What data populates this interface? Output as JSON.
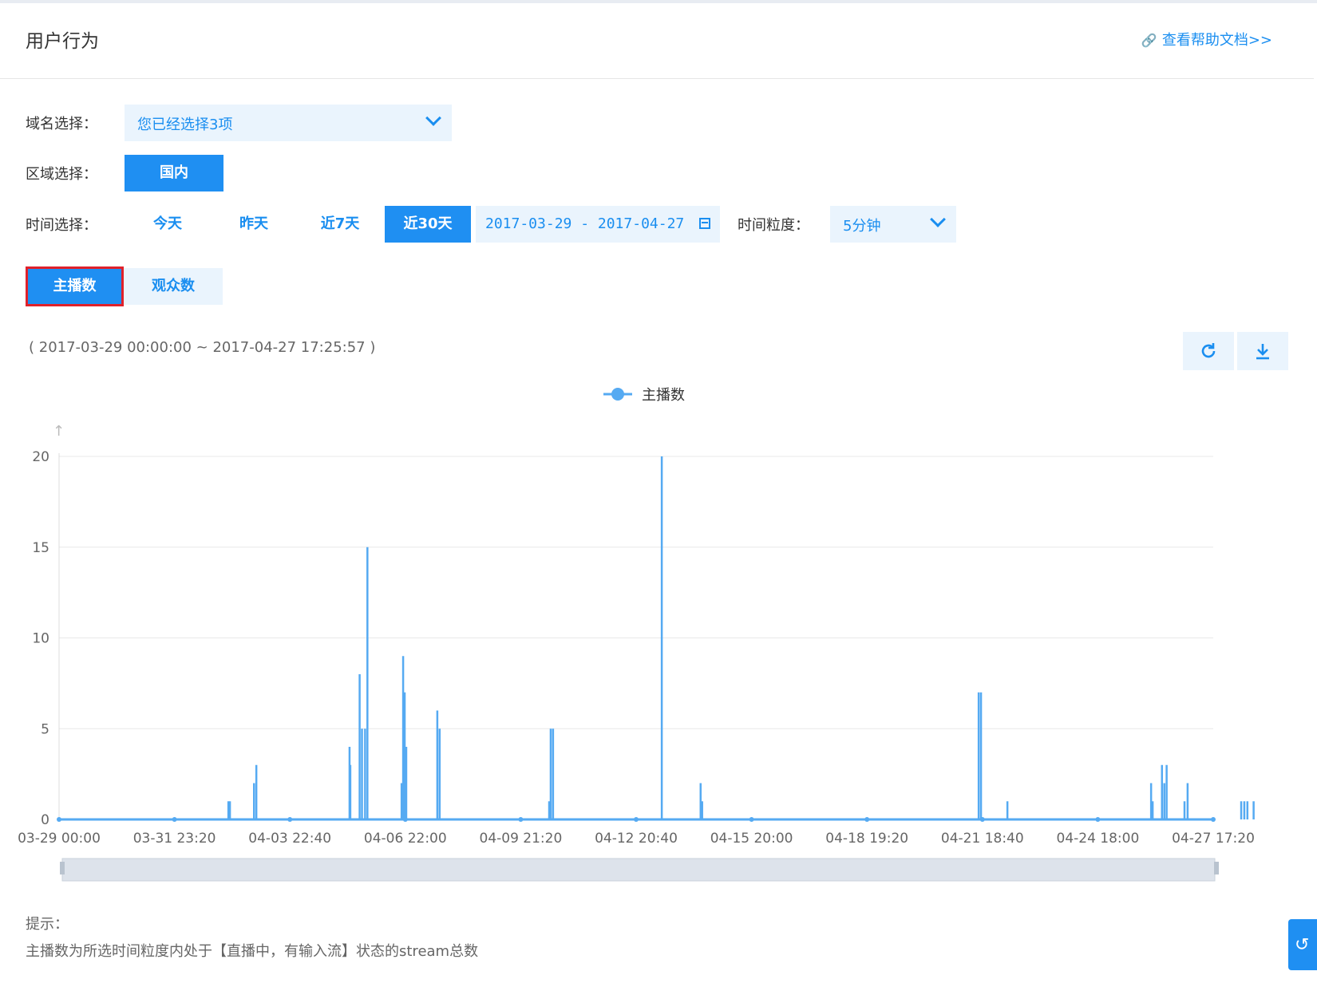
{
  "header": {
    "title": "用户行为",
    "help_link": "查看帮助文档>>"
  },
  "filters": {
    "domain_label": "域名选择：",
    "domain_value": "您已经选择3项",
    "region_label": "区域选择：",
    "region_value": "国内",
    "time_label": "时间选择：",
    "time_options": [
      "今天",
      "昨天",
      "近7天",
      "近30天"
    ],
    "time_selected": "近30天",
    "date_range": "2017-03-29 - 2017-04-27",
    "granularity_label": "时间粒度：",
    "granularity_value": "5分钟"
  },
  "tabs": {
    "active": "主播数",
    "inactive": "观众数"
  },
  "range_text": "( 2017-03-29 00:00:00 ~ 2017-04-27 17:25:57 )",
  "colors": {
    "accent": "#1f8ff2",
    "series": "#55aaf2",
    "highlight_border": "#e0212b"
  },
  "chart_data": {
    "type": "line",
    "legend": "主播数",
    "legend_position": "top-center",
    "ylim": [
      0,
      20
    ],
    "y_ticks": [
      0,
      5,
      10,
      15,
      20
    ],
    "y_arrow": "↑",
    "x_ticks": [
      "03-29 00:00",
      "03-31 23:20",
      "04-03 22:40",
      "04-06 22:00",
      "04-09 21:20",
      "04-12 20:40",
      "04-15 20:00",
      "04-18 19:20",
      "04-21 18:40",
      "04-24 18:00",
      "04-27 17:20"
    ],
    "x_range_days": [
      0,
      29.72
    ],
    "grid": true,
    "series": [
      {
        "name": "主播数",
        "spikes": [
          {
            "day": 4.36,
            "v": 1
          },
          {
            "day": 4.4,
            "v": 1
          },
          {
            "day": 5.02,
            "v": 2
          },
          {
            "day": 5.08,
            "v": 3
          },
          {
            "day": 7.48,
            "v": 4
          },
          {
            "day": 7.5,
            "v": 3
          },
          {
            "day": 7.74,
            "v": 8
          },
          {
            "day": 7.8,
            "v": 5
          },
          {
            "day": 7.88,
            "v": 5
          },
          {
            "day": 7.94,
            "v": 15
          },
          {
            "day": 8.82,
            "v": 2
          },
          {
            "day": 8.86,
            "v": 9
          },
          {
            "day": 8.9,
            "v": 7
          },
          {
            "day": 8.94,
            "v": 4
          },
          {
            "day": 9.74,
            "v": 6
          },
          {
            "day": 9.8,
            "v": 5
          },
          {
            "day": 12.62,
            "v": 1
          },
          {
            "day": 12.66,
            "v": 5
          },
          {
            "day": 12.72,
            "v": 5
          },
          {
            "day": 15.52,
            "v": 20
          },
          {
            "day": 16.52,
            "v": 2
          },
          {
            "day": 16.56,
            "v": 1
          },
          {
            "day": 23.68,
            "v": 7
          },
          {
            "day": 23.74,
            "v": 7
          },
          {
            "day": 24.42,
            "v": 1
          },
          {
            "day": 28.12,
            "v": 2
          },
          {
            "day": 28.16,
            "v": 1
          },
          {
            "day": 28.4,
            "v": 3
          },
          {
            "day": 28.46,
            "v": 2
          },
          {
            "day": 28.52,
            "v": 3
          },
          {
            "day": 28.98,
            "v": 1
          },
          {
            "day": 29.06,
            "v": 2
          },
          {
            "day": 30.44,
            "v": 1
          },
          {
            "day": 30.52,
            "v": 1
          },
          {
            "day": 30.6,
            "v": 1
          },
          {
            "day": 30.76,
            "v": 1
          }
        ]
      }
    ]
  },
  "hint": {
    "label": "提示：",
    "text": "主播数为所选时间粒度内处于【直播中，有输入流】状态的stream总数"
  }
}
